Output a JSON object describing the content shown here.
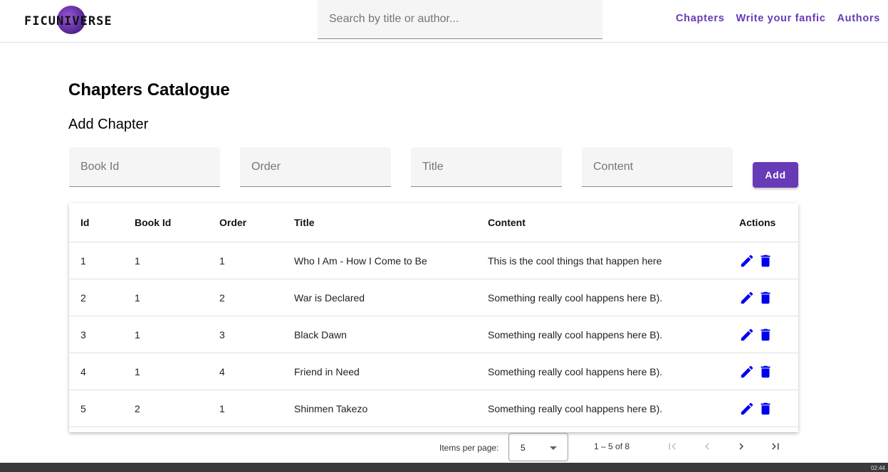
{
  "header": {
    "logo_text": "FICUNIVERSE",
    "search_placeholder": "Search by title or author...",
    "nav": [
      "Chapters",
      "Write your fanfic",
      "Authors"
    ]
  },
  "page": {
    "title": "Chapters Catalogue",
    "section_title": "Add Chapter",
    "fields": {
      "book_id": "Book Id",
      "order": "Order",
      "title": "Title",
      "content": "Content"
    },
    "add_label": "Add"
  },
  "table": {
    "columns": [
      "Id",
      "Book Id",
      "Order",
      "Title",
      "Content",
      "Actions"
    ],
    "rows": [
      {
        "id": "1",
        "book_id": "1",
        "order": "1",
        "title": "Who I Am - How I Come to Be",
        "content": "This is the cool things that happen here"
      },
      {
        "id": "2",
        "book_id": "1",
        "order": "2",
        "title": "War is Declared",
        "content": "Something really cool happens here B)."
      },
      {
        "id": "3",
        "book_id": "1",
        "order": "3",
        "title": "Black Dawn",
        "content": "Something really cool happens here B)."
      },
      {
        "id": "4",
        "book_id": "1",
        "order": "4",
        "title": "Friend in Need",
        "content": "Something really cool happens here B)."
      },
      {
        "id": "5",
        "book_id": "2",
        "order": "1",
        "title": "Shinmen Takezo",
        "content": "Something really cool happens here B)."
      }
    ],
    "action_icons": [
      "edit-icon",
      "delete-icon"
    ],
    "action_color": "#0000ee"
  },
  "paginator": {
    "items_label": "Items per page:",
    "page_size": "5",
    "range": "1 – 5 of 8"
  },
  "taskbar": {
    "clock": "02:44"
  },
  "colors": {
    "accent": "#673ab7",
    "action": "#0000ee"
  }
}
